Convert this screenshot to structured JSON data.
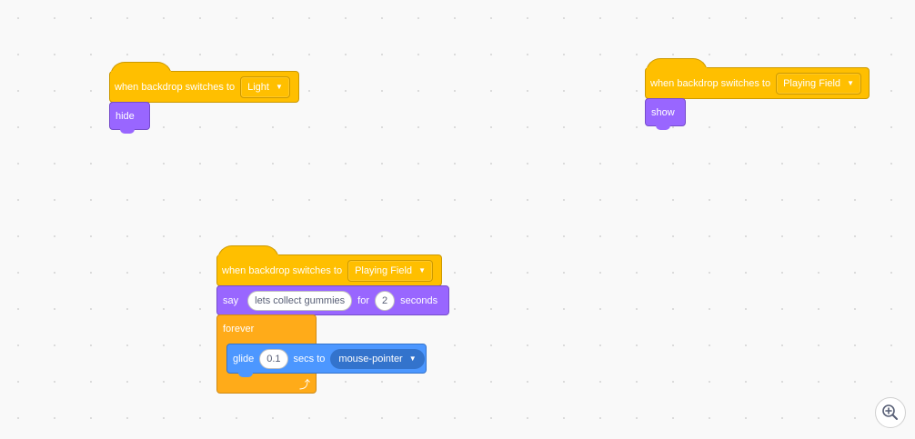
{
  "script1": {
    "hat_label": "when backdrop switches to",
    "backdrop": "Light",
    "action": "hide"
  },
  "script2": {
    "hat_label": "when backdrop switches to",
    "backdrop": "Playing Field",
    "action": "show"
  },
  "script3": {
    "hat_label": "when backdrop switches to",
    "backdrop": "Playing Field",
    "say": {
      "label": "say",
      "message": "lets collect gummies",
      "for_label": "for",
      "seconds_value": "2",
      "seconds_label": "seconds"
    },
    "forever_label": "forever",
    "glide": {
      "label": "glide",
      "value": "0.1",
      "secs_label": "secs to",
      "target": "mouse-pointer"
    }
  },
  "icons": {
    "dropdown": "chevron-down-icon",
    "loop": "loop-arrow-icon",
    "zoom_in": "zoom-in-icon"
  },
  "colors": {
    "events": "#ffbf00",
    "looks": "#9966ff",
    "control": "#ffab19",
    "motion": "#4c97ff",
    "background": "#f9f9f9"
  }
}
